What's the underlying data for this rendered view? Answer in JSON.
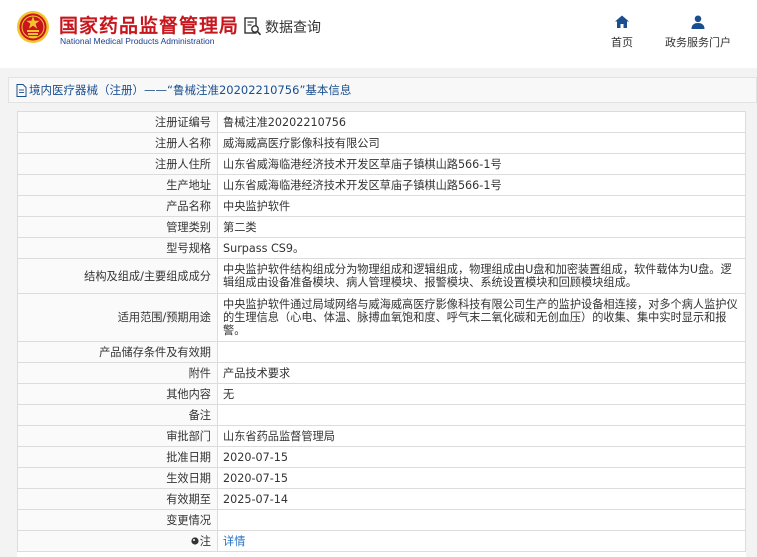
{
  "header": {
    "logo_cn": "国家药品监督管理局",
    "logo_en": "National Medical Products Administration",
    "query_label": "数据查询",
    "nav": [
      {
        "label": "首页",
        "icon": "home-icon"
      },
      {
        "label": "政务服务门户",
        "icon": "user-icon"
      }
    ]
  },
  "title": "境内医疗器械（注册）——“鲁械注准20202210756”基本信息",
  "rows": [
    {
      "label": "注册证编号",
      "value": "鲁械注准20202210756"
    },
    {
      "label": "注册人名称",
      "value": "威海威高医疗影像科技有限公司"
    },
    {
      "label": "注册人住所",
      "value": "山东省威海临港经济技术开发区草庙子镇棋山路566-1号"
    },
    {
      "label": "生产地址",
      "value": "山东省威海临港经济技术开发区草庙子镇棋山路566-1号"
    },
    {
      "label": "产品名称",
      "value": "中央监护软件"
    },
    {
      "label": "管理类别",
      "value": "第二类"
    },
    {
      "label": "型号规格",
      "value": "Surpass CS9。"
    },
    {
      "label": "结构及组成/主要组成成分",
      "value": "中央监护软件结构组成分为物理组成和逻辑组成，物理组成由U盘和加密装置组成，软件载体为U盘。逻辑组成由设备准备模块、病人管理模块、报警模块、系统设置模块和回顾模块组成。"
    },
    {
      "label": "适用范围/预期用途",
      "value": "中央监护软件通过局域网络与威海威高医疗影像科技有限公司生产的监护设备相连接，对多个病人监护仪的生理信息（心电、体温、脉搏血氧饱和度、呼气末二氧化碳和无创血压）的收集、集中实时显示和报警。"
    },
    {
      "label": "产品储存条件及有效期",
      "value": ""
    },
    {
      "label": "附件",
      "value": "产品技术要求"
    },
    {
      "label": "其他内容",
      "value": "无"
    },
    {
      "label": "备注",
      "value": ""
    },
    {
      "label": "审批部门",
      "value": "山东省药品监督管理局"
    },
    {
      "label": "批准日期",
      "value": "2020-07-15"
    },
    {
      "label": "生效日期",
      "value": "2020-07-15"
    },
    {
      "label": "有效期至",
      "value": "2025-07-14"
    },
    {
      "label": "变更情况",
      "value": ""
    }
  ],
  "note_row": {
    "label": "注",
    "link": "详情",
    "icon": "pin-icon"
  },
  "colors": {
    "brand_red": "#c8161d",
    "brand_blue": "#1a3f8f",
    "title_blue": "#1a4f8f",
    "link_blue": "#1e6fc6"
  }
}
